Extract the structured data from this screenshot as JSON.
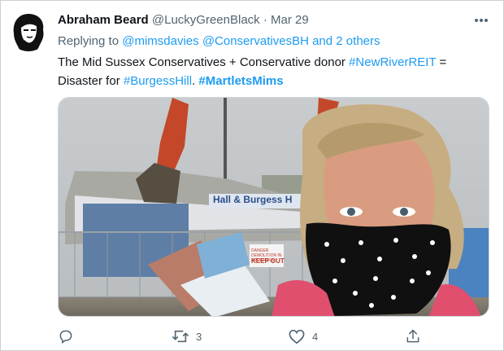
{
  "tweet": {
    "display_name": "Abraham Beard",
    "handle": "@LuckyGreenBlack",
    "separator": "·",
    "date": "Mar 29",
    "replying_prefix": "Replying to",
    "replying_to_1": "@mimsdavies",
    "replying_to_2": "@ConservativesBH",
    "replying_and": "and",
    "replying_others": "2 others",
    "text_part1": "The Mid Sussex Conservatives + Conservative donor",
    "hashtag_1": "#NewRiverREIT",
    "text_part2": "=",
    "text_part3": "Disaster for",
    "hashtag_2": "#BurgessHill",
    "hashtag_3": "#MartletsMims",
    "media_sign_text": "Hall & Burgess H",
    "media_keep_out": "KEEP OUT",
    "media_sign_small": "DANGER DEMOLITION IN PROGRESS"
  },
  "actions": {
    "reply_count": "",
    "retweet_count": "3",
    "like_count": "4"
  },
  "colors": {
    "link": "#1d9bf0",
    "muted": "#536471",
    "text": "#0f1419"
  },
  "icons": [
    "avatar-portrait",
    "more-icon",
    "reply-icon",
    "retweet-icon",
    "like-icon",
    "share-icon"
  ]
}
